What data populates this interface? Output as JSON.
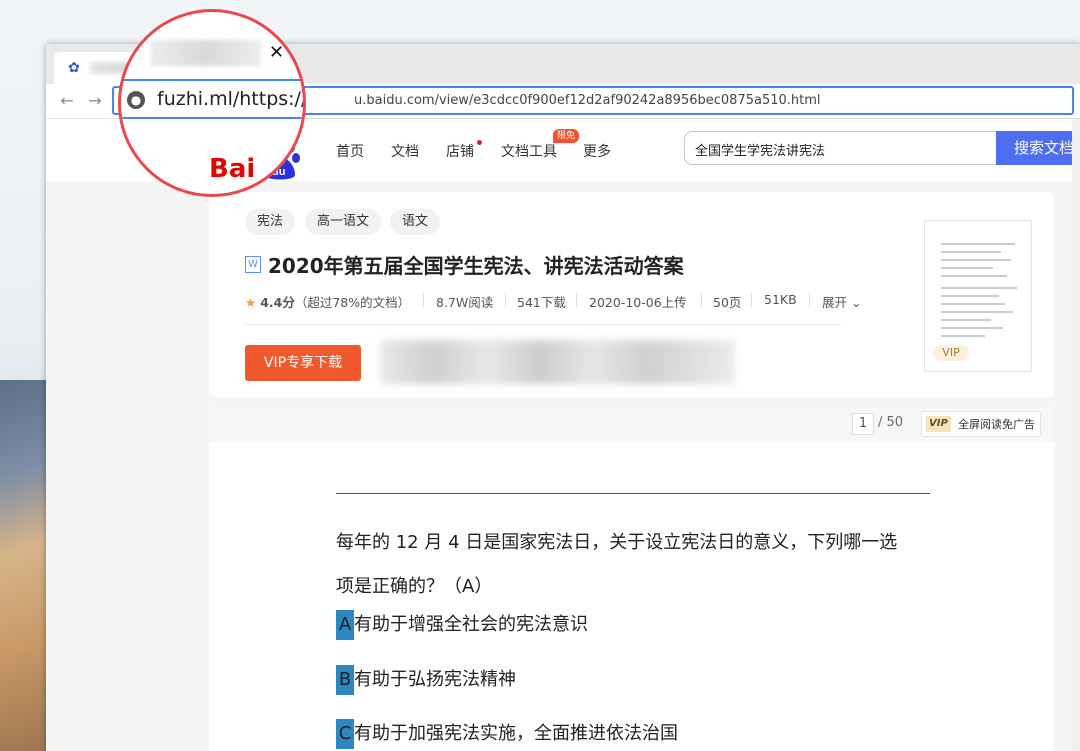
{
  "browser": {
    "url": "u.baidu.com/view/e3cdcc0f900ef12d2af90242a8956bec0875a510.html",
    "magnified_text": "fuzhi.ml/https://",
    "tab_close": "✕",
    "back": "←",
    "forward": "→"
  },
  "site": {
    "logo": "Bai",
    "nav": [
      "首页",
      "文档",
      "店铺",
      "文档工具",
      "更多"
    ],
    "nav_badge": "限免",
    "search_value": "全国学生学宪法讲宪法",
    "search_button": "搜索文档"
  },
  "doc": {
    "tags": [
      "宪法",
      "高一语文",
      "语文"
    ],
    "type_icon": "W",
    "title": "2020年第五届全国学生宪法、讲宪法活动答案",
    "rating": "4.4分",
    "rating_note": "（超过78%的文档）",
    "views": "8.7W阅读",
    "downloads": "541下载",
    "upload_date": "2020-10-06上传",
    "pages": "50页",
    "size": "51KB",
    "expand": "展开",
    "vip_download": "VIP专享下载",
    "thumb_badge": "VIP"
  },
  "reader": {
    "current_page": "1",
    "total_pages": "/ 50",
    "vip_logo": "VIP",
    "fullscreen": "全屏阅读免广告",
    "question_line1": "每年的 12 月 4 日是国家宪法日，关于设立宪法日的意义，下列哪一选",
    "question_line2": "项是正确的？（A）",
    "options": [
      {
        "letter": "A",
        "text": "有助于增强全社会的宪法意识"
      },
      {
        "letter": "B",
        "text": "有助于弘扬宪法精神"
      },
      {
        "letter": "C",
        "text": "有助于加强宪法实施，全面推进依法治国"
      }
    ]
  },
  "colors": {
    "highlight_circle": "#e8484e",
    "search_button": "#4e6ef2",
    "vip_button": "#f0592e",
    "option_highlight": "#2e86c1"
  }
}
